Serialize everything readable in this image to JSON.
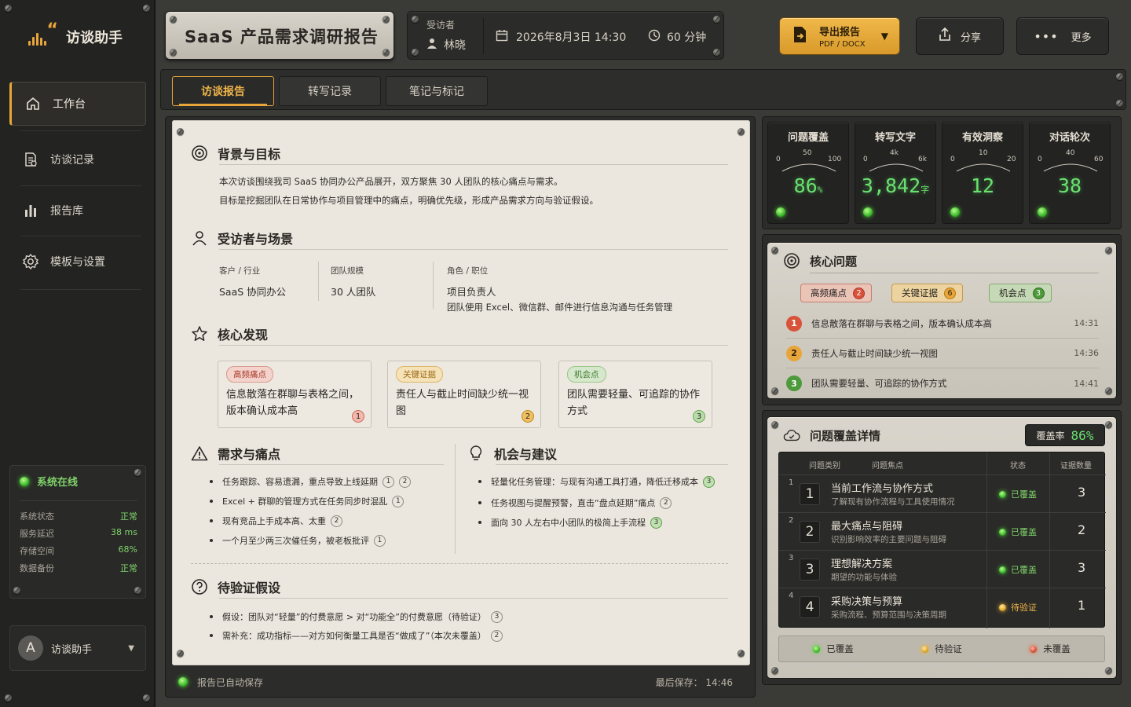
{
  "app": {
    "name": "访谈助手"
  },
  "sidebar": {
    "items": [
      {
        "label": "工作台",
        "icon": "home-icon"
      },
      {
        "label": "访谈记录",
        "icon": "document-icon"
      },
      {
        "label": "报告库",
        "icon": "bar-chart-icon"
      },
      {
        "label": "模板与设置",
        "icon": "gear-icon"
      }
    ],
    "system": {
      "title": "系统在线",
      "rows": [
        {
          "label": "系统状态",
          "value": "正常"
        },
        {
          "label": "服务延迟",
          "value": "38 ms"
        },
        {
          "label": "存储空间",
          "value": "68%"
        },
        {
          "label": "数据备份",
          "value": "正常"
        }
      ]
    },
    "user": {
      "initial": "A",
      "name": "访谈助手"
    }
  },
  "header": {
    "title": "SaaS 产品需求调研报告",
    "interviewee_label": "受访者",
    "interviewee": "林晓",
    "datetime": "2026年8月3日  14:30",
    "duration": "60 分钟",
    "export_label": "导出报告",
    "export_sub": "PDF / DOCX",
    "share_label": "分享",
    "more_label": "更多"
  },
  "tabs": [
    {
      "label": "访谈报告",
      "active": true
    },
    {
      "label": "转写记录",
      "active": false
    },
    {
      "label": "笔记与标记",
      "active": false
    }
  ],
  "report": {
    "background": {
      "title": "背景与目标",
      "lines": [
        "本次访谈围绕我司 SaaS 协同办公产品展开，双方聚焦  30 人团队的核心痛点与需求。",
        "目标是挖掘团队在日常协作与项目管理中的痛点，明确优先级，形成产品需求方向与验证假设。"
      ]
    },
    "interviewee": {
      "title": "受访者与场景",
      "customer_label": "客户 / 行业",
      "customer_value": "SaaS 协同办公",
      "team_label": "团队规模",
      "team_value": "30 人团队",
      "role_label": "角色 / 职位",
      "role_value": "项目负责人",
      "role_desc": "团队使用 Excel、微信群、邮件进行信息沟通与任务管理"
    },
    "findings": {
      "title": "核心发现",
      "cards": [
        {
          "tag": "高频痛点",
          "text": "信息散落在群聊与表格之间，版本确认成本高",
          "num": "1"
        },
        {
          "tag": "关键证据",
          "text": "责任人与截止时间缺少统一视图",
          "num": "2"
        },
        {
          "tag": "机会点",
          "text": "团队需要轻量、可追踪的协作方式",
          "num": "3"
        }
      ]
    },
    "needs": {
      "title": "需求与痛点",
      "items": [
        {
          "text": "任务跟踪、容易遗漏，重点导致上线延期",
          "refs": [
            "1",
            "2"
          ]
        },
        {
          "text": "Excel + 群聊的管理方式在任务同步时混乱",
          "refs": [
            "1"
          ]
        },
        {
          "text": "现有竞品上手成本高、太重",
          "refs": [
            "2"
          ]
        },
        {
          "text": "一个月至少两三次催任务，被老板批评",
          "refs": [
            "1"
          ]
        }
      ]
    },
    "opportunities": {
      "title": "机会与建议",
      "items": [
        {
          "text": "轻量化任务管理：与现有沟通工具打通，降低迁移成本",
          "refs": [
            "3"
          ]
        },
        {
          "text": "任务视图与提醒预警，直击“盘点延期”痛点",
          "refs": [
            "2"
          ]
        },
        {
          "text": "面向 30 人左右中小团队的极简上手流程",
          "refs": [
            "3"
          ]
        }
      ]
    },
    "hypotheses": {
      "title": "待验证假设",
      "items": [
        {
          "text": "假设：团队对“轻量”的付费意愿 > 对“功能全”的付费意愿（待验证）",
          "refs": [
            "3"
          ]
        },
        {
          "text": "需补充：成功指标——对方如何衡量工具是否“做成了”（本次未覆盖）",
          "refs": [
            "2"
          ]
        }
      ]
    },
    "footer": {
      "autosave": "报告已自动保存",
      "last_saved": "最后保存：  14:46"
    }
  },
  "gauges": [
    {
      "title": "问题覆盖",
      "value": "86",
      "unit": "%",
      "ticks": [
        "0",
        "50",
        "100"
      ],
      "fraction": 0.86
    },
    {
      "title": "转写文字",
      "value": "3,842",
      "unit": "字",
      "ticks": [
        "0",
        "4k",
        "6k"
      ],
      "fraction": 0.64
    },
    {
      "title": "有效洞察",
      "value": "12",
      "unit": "",
      "ticks": [
        "0",
        "10",
        "20"
      ],
      "fraction": 0.6
    },
    {
      "title": "对话轮次",
      "value": "38",
      "unit": "",
      "ticks": [
        "0",
        "40",
        "60"
      ],
      "fraction": 0.63
    }
  ],
  "core_issues": {
    "title": "核心问题",
    "pills": [
      {
        "label": "高频痛点",
        "count": "2"
      },
      {
        "label": "关键证据",
        "count": "6"
      },
      {
        "label": "机会点",
        "count": "3"
      }
    ],
    "items": [
      {
        "num": "1",
        "text": "信息散落在群聊与表格之间，版本确认成本高",
        "time": "14:31"
      },
      {
        "num": "2",
        "text": "责任人与截止时间缺少统一视图",
        "time": "14:36"
      },
      {
        "num": "3",
        "text": "团队需要轻量、可追踪的协作方式",
        "time": "14:41"
      }
    ]
  },
  "coverage": {
    "title": "问题覆盖详情",
    "rate_label": "覆盖率",
    "rate": "86%",
    "headers": {
      "category": "问题类别",
      "focus": "问题焦点",
      "status": "状态",
      "evidence": "证据数量"
    },
    "rows": [
      {
        "idx": "1",
        "num": "1",
        "title": "当前工作流与协作方式",
        "desc": "了解现有协作流程与工具使用情况",
        "status": "已覆盖",
        "count": "3"
      },
      {
        "idx": "2",
        "num": "2",
        "title": "最大痛点与阻碍",
        "desc": "识别影响效率的主要问题与阻碍",
        "status": "已覆盖",
        "count": "2"
      },
      {
        "idx": "3",
        "num": "3",
        "title": "理想解决方案",
        "desc": "期望的功能与体验",
        "status": "已覆盖",
        "count": "3"
      },
      {
        "idx": "4",
        "num": "4",
        "title": "采购决策与预算",
        "desc": "采购流程、预算范围与决策周期",
        "status": "待验证",
        "count": "1"
      }
    ],
    "legend": [
      "已覆盖",
      "待验证",
      "未覆盖"
    ]
  },
  "colors": {
    "accent": "#e8a53a",
    "led_green": "#4dd33a",
    "panel": "#d9d5cc"
  }
}
